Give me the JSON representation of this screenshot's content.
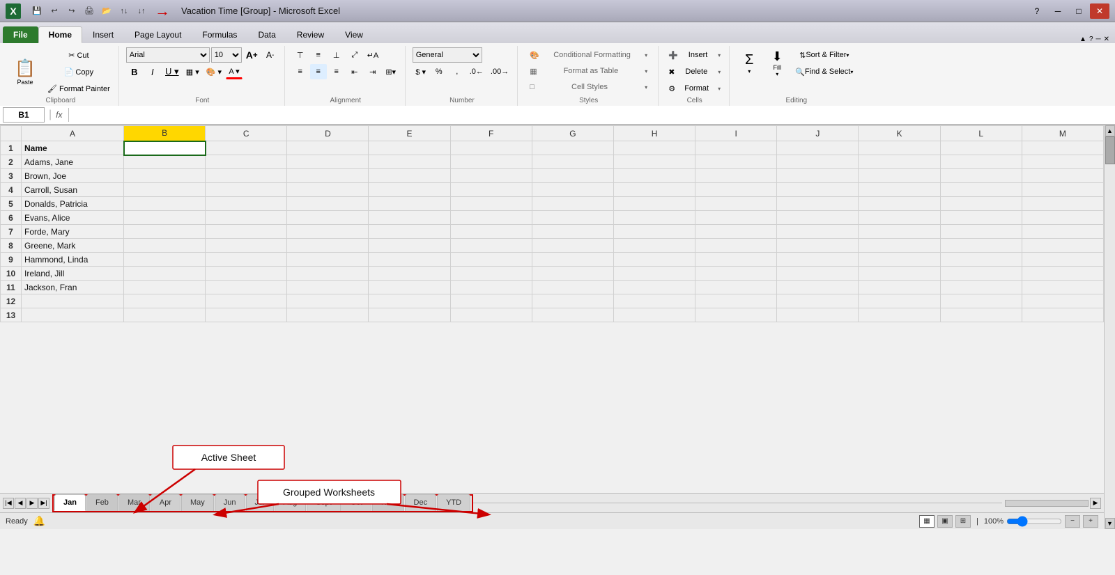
{
  "titleBar": {
    "logo": "X",
    "title": "Vacation Time  [Group] - Microsoft Excel",
    "arrowLabel": "→",
    "minBtn": "─",
    "maxBtn": "□",
    "closeBtn": "✕",
    "quickAccess": [
      "💾",
      "↩",
      "↪",
      "🖨",
      "🔍",
      "📄",
      "🔧",
      "↕",
      "↕"
    ]
  },
  "ribbon": {
    "tabs": [
      {
        "label": "File",
        "isFile": true
      },
      {
        "label": "Home",
        "active": true
      },
      {
        "label": "Insert"
      },
      {
        "label": "Page Layout"
      },
      {
        "label": "Formulas"
      },
      {
        "label": "Data"
      },
      {
        "label": "Review"
      },
      {
        "label": "View"
      }
    ],
    "groups": {
      "clipboard": {
        "label": "Clipboard",
        "pasteLabel": "Paste",
        "cutLabel": "Cut",
        "copyLabel": "Copy",
        "formatPainterLabel": "Format Painter"
      },
      "font": {
        "label": "Font",
        "fontName": "Arial",
        "fontSize": "10",
        "growLabel": "A",
        "shrinkLabel": "A",
        "boldLabel": "B",
        "italicLabel": "I",
        "underlineLabel": "U",
        "borderLabel": "▦",
        "fillLabel": "A",
        "colorLabel": "A"
      },
      "alignment": {
        "label": "Alignment",
        "topAlign": "⊤",
        "midAlign": "≡",
        "botAlign": "⊥",
        "leftAlign": "≡",
        "centerAlign": "≡",
        "rightAlign": "≡",
        "wrapLabel": "Wrap Text",
        "mergeLabel": "Merge & Center"
      },
      "number": {
        "label": "Number",
        "format": "General",
        "dollarLabel": "$",
        "percentLabel": "%",
        "commaLabel": ","
      },
      "styles": {
        "label": "Styles",
        "conditionalFormatting": "Conditional Formatting",
        "formatAsTable": "Format as Table",
        "cellStyles": "Cell Styles"
      },
      "cells": {
        "label": "Cells",
        "insertLabel": "Insert",
        "deleteLabel": "Delete",
        "formatLabel": "Format"
      },
      "editing": {
        "label": "Editing",
        "sumLabel": "Σ",
        "sortLabel": "Sort & Filter",
        "findLabel": "Find & Select"
      }
    }
  },
  "formulaBar": {
    "cellRef": "B1",
    "fxLabel": "fx"
  },
  "spreadsheet": {
    "columns": [
      "A",
      "B",
      "C",
      "D",
      "E",
      "F",
      "G",
      "H",
      "I",
      "J",
      "K",
      "L",
      "M"
    ],
    "activeCol": "B",
    "activeRow": 1,
    "rows": [
      {
        "rowNum": 1,
        "cells": [
          {
            "col": "A",
            "value": "Name",
            "bold": true
          },
          {
            "col": "B",
            "value": "",
            "selected": true
          },
          {
            "col": "C",
            "value": ""
          },
          {
            "col": "D",
            "value": ""
          },
          {
            "col": "E",
            "value": ""
          },
          {
            "col": "F",
            "value": ""
          },
          {
            "col": "G",
            "value": ""
          },
          {
            "col": "H",
            "value": ""
          },
          {
            "col": "I",
            "value": ""
          },
          {
            "col": "J",
            "value": ""
          },
          {
            "col": "K",
            "value": ""
          },
          {
            "col": "L",
            "value": ""
          },
          {
            "col": "M",
            "value": ""
          }
        ]
      },
      {
        "rowNum": 2,
        "cells": [
          {
            "col": "A",
            "value": "Adams, Jane"
          },
          {
            "col": "B",
            "value": ""
          },
          {
            "col": "C",
            "value": ""
          },
          {
            "col": "D",
            "value": ""
          },
          {
            "col": "E",
            "value": ""
          },
          {
            "col": "F",
            "value": ""
          },
          {
            "col": "G",
            "value": ""
          },
          {
            "col": "H",
            "value": ""
          },
          {
            "col": "I",
            "value": ""
          },
          {
            "col": "J",
            "value": ""
          },
          {
            "col": "K",
            "value": ""
          },
          {
            "col": "L",
            "value": ""
          },
          {
            "col": "M",
            "value": ""
          }
        ]
      },
      {
        "rowNum": 3,
        "cells": [
          {
            "col": "A",
            "value": "Brown, Joe"
          },
          {
            "col": "B",
            "value": ""
          },
          {
            "col": "C",
            "value": ""
          },
          {
            "col": "D",
            "value": ""
          },
          {
            "col": "E",
            "value": ""
          },
          {
            "col": "F",
            "value": ""
          },
          {
            "col": "G",
            "value": ""
          },
          {
            "col": "H",
            "value": ""
          },
          {
            "col": "I",
            "value": ""
          },
          {
            "col": "J",
            "value": ""
          },
          {
            "col": "K",
            "value": ""
          },
          {
            "col": "L",
            "value": ""
          },
          {
            "col": "M",
            "value": ""
          }
        ]
      },
      {
        "rowNum": 4,
        "cells": [
          {
            "col": "A",
            "value": "Carroll, Susan"
          },
          {
            "col": "B",
            "value": ""
          },
          {
            "col": "C",
            "value": ""
          },
          {
            "col": "D",
            "value": ""
          },
          {
            "col": "E",
            "value": ""
          },
          {
            "col": "F",
            "value": ""
          },
          {
            "col": "G",
            "value": ""
          },
          {
            "col": "H",
            "value": ""
          },
          {
            "col": "I",
            "value": ""
          },
          {
            "col": "J",
            "value": ""
          },
          {
            "col": "K",
            "value": ""
          },
          {
            "col": "L",
            "value": ""
          },
          {
            "col": "M",
            "value": ""
          }
        ]
      },
      {
        "rowNum": 5,
        "cells": [
          {
            "col": "A",
            "value": "Donalds, Patricia"
          },
          {
            "col": "B",
            "value": ""
          },
          {
            "col": "C",
            "value": ""
          },
          {
            "col": "D",
            "value": ""
          },
          {
            "col": "E",
            "value": ""
          },
          {
            "col": "F",
            "value": ""
          },
          {
            "col": "G",
            "value": ""
          },
          {
            "col": "H",
            "value": ""
          },
          {
            "col": "I",
            "value": ""
          },
          {
            "col": "J",
            "value": ""
          },
          {
            "col": "K",
            "value": ""
          },
          {
            "col": "L",
            "value": ""
          },
          {
            "col": "M",
            "value": ""
          }
        ]
      },
      {
        "rowNum": 6,
        "cells": [
          {
            "col": "A",
            "value": "Evans, Alice"
          },
          {
            "col": "B",
            "value": ""
          },
          {
            "col": "C",
            "value": ""
          },
          {
            "col": "D",
            "value": ""
          },
          {
            "col": "E",
            "value": ""
          },
          {
            "col": "F",
            "value": ""
          },
          {
            "col": "G",
            "value": ""
          },
          {
            "col": "H",
            "value": ""
          },
          {
            "col": "I",
            "value": ""
          },
          {
            "col": "J",
            "value": ""
          },
          {
            "col": "K",
            "value": ""
          },
          {
            "col": "L",
            "value": ""
          },
          {
            "col": "M",
            "value": ""
          }
        ]
      },
      {
        "rowNum": 7,
        "cells": [
          {
            "col": "A",
            "value": "Forde, Mary"
          },
          {
            "col": "B",
            "value": ""
          },
          {
            "col": "C",
            "value": ""
          },
          {
            "col": "D",
            "value": ""
          },
          {
            "col": "E",
            "value": ""
          },
          {
            "col": "F",
            "value": ""
          },
          {
            "col": "G",
            "value": ""
          },
          {
            "col": "H",
            "value": ""
          },
          {
            "col": "I",
            "value": ""
          },
          {
            "col": "J",
            "value": ""
          },
          {
            "col": "K",
            "value": ""
          },
          {
            "col": "L",
            "value": ""
          },
          {
            "col": "M",
            "value": ""
          }
        ]
      },
      {
        "rowNum": 8,
        "cells": [
          {
            "col": "A",
            "value": "Greene, Mark"
          },
          {
            "col": "B",
            "value": ""
          },
          {
            "col": "C",
            "value": ""
          },
          {
            "col": "D",
            "value": ""
          },
          {
            "col": "E",
            "value": ""
          },
          {
            "col": "F",
            "value": ""
          },
          {
            "col": "G",
            "value": ""
          },
          {
            "col": "H",
            "value": ""
          },
          {
            "col": "I",
            "value": ""
          },
          {
            "col": "J",
            "value": ""
          },
          {
            "col": "K",
            "value": ""
          },
          {
            "col": "L",
            "value": ""
          },
          {
            "col": "M",
            "value": ""
          }
        ]
      },
      {
        "rowNum": 9,
        "cells": [
          {
            "col": "A",
            "value": "Hammond, Linda"
          },
          {
            "col": "B",
            "value": ""
          },
          {
            "col": "C",
            "value": ""
          },
          {
            "col": "D",
            "value": ""
          },
          {
            "col": "E",
            "value": ""
          },
          {
            "col": "F",
            "value": ""
          },
          {
            "col": "G",
            "value": ""
          },
          {
            "col": "H",
            "value": ""
          },
          {
            "col": "I",
            "value": ""
          },
          {
            "col": "J",
            "value": ""
          },
          {
            "col": "K",
            "value": ""
          },
          {
            "col": "L",
            "value": ""
          },
          {
            "col": "M",
            "value": ""
          }
        ]
      },
      {
        "rowNum": 10,
        "cells": [
          {
            "col": "A",
            "value": "Ireland, Jill"
          },
          {
            "col": "B",
            "value": ""
          },
          {
            "col": "C",
            "value": ""
          },
          {
            "col": "D",
            "value": ""
          },
          {
            "col": "E",
            "value": ""
          },
          {
            "col": "F",
            "value": ""
          },
          {
            "col": "G",
            "value": ""
          },
          {
            "col": "H",
            "value": ""
          },
          {
            "col": "I",
            "value": ""
          },
          {
            "col": "J",
            "value": ""
          },
          {
            "col": "K",
            "value": ""
          },
          {
            "col": "L",
            "value": ""
          },
          {
            "col": "M",
            "value": ""
          }
        ]
      },
      {
        "rowNum": 11,
        "cells": [
          {
            "col": "A",
            "value": "Jackson, Fran"
          },
          {
            "col": "B",
            "value": ""
          },
          {
            "col": "C",
            "value": ""
          },
          {
            "col": "D",
            "value": ""
          },
          {
            "col": "E",
            "value": ""
          },
          {
            "col": "F",
            "value": ""
          },
          {
            "col": "G",
            "value": ""
          },
          {
            "col": "H",
            "value": ""
          },
          {
            "col": "I",
            "value": ""
          },
          {
            "col": "J",
            "value": ""
          },
          {
            "col": "K",
            "value": ""
          },
          {
            "col": "L",
            "value": ""
          },
          {
            "col": "M",
            "value": ""
          }
        ]
      },
      {
        "rowNum": 12,
        "cells": [
          {
            "col": "A",
            "value": ""
          },
          {
            "col": "B",
            "value": ""
          },
          {
            "col": "C",
            "value": ""
          },
          {
            "col": "D",
            "value": ""
          },
          {
            "col": "E",
            "value": ""
          },
          {
            "col": "F",
            "value": ""
          },
          {
            "col": "G",
            "value": ""
          },
          {
            "col": "H",
            "value": ""
          },
          {
            "col": "I",
            "value": ""
          },
          {
            "col": "J",
            "value": ""
          },
          {
            "col": "K",
            "value": ""
          },
          {
            "col": "L",
            "value": ""
          },
          {
            "col": "M",
            "value": ""
          }
        ]
      },
      {
        "rowNum": 13,
        "cells": [
          {
            "col": "A",
            "value": ""
          },
          {
            "col": "B",
            "value": ""
          },
          {
            "col": "C",
            "value": ""
          },
          {
            "col": "D",
            "value": ""
          },
          {
            "col": "E",
            "value": ""
          },
          {
            "col": "F",
            "value": ""
          },
          {
            "col": "G",
            "value": ""
          },
          {
            "col": "H",
            "value": ""
          },
          {
            "col": "I",
            "value": ""
          },
          {
            "col": "J",
            "value": ""
          },
          {
            "col": "K",
            "value": ""
          },
          {
            "col": "L",
            "value": ""
          },
          {
            "col": "M",
            "value": ""
          }
        ]
      }
    ]
  },
  "sheetTabs": {
    "tabs": [
      {
        "label": "Jan",
        "active": true,
        "grouped": true
      },
      {
        "label": "Feb",
        "grouped": true
      },
      {
        "label": "Mar",
        "grouped": true
      },
      {
        "label": "Apr",
        "grouped": false
      },
      {
        "label": "May",
        "grouped": false
      },
      {
        "label": "Jun",
        "grouped": false
      },
      {
        "label": "Jul",
        "grouped": false
      },
      {
        "label": "Aug",
        "grouped": false
      },
      {
        "label": "Sept",
        "grouped": false
      },
      {
        "label": "Oct",
        "grouped": false
      },
      {
        "label": "Nov",
        "grouped": true
      },
      {
        "label": "Dec",
        "grouped": false
      },
      {
        "label": "YTD",
        "grouped": false
      }
    ]
  },
  "annotations": {
    "activeSheet": "Active Sheet",
    "groupedWorksheets": "Grouped Worksheets"
  },
  "statusBar": {
    "readyLabel": "Ready",
    "zoomLabel": "100%",
    "viewNormal": "▦",
    "viewPage": "▣",
    "viewBreak": "⊞"
  }
}
